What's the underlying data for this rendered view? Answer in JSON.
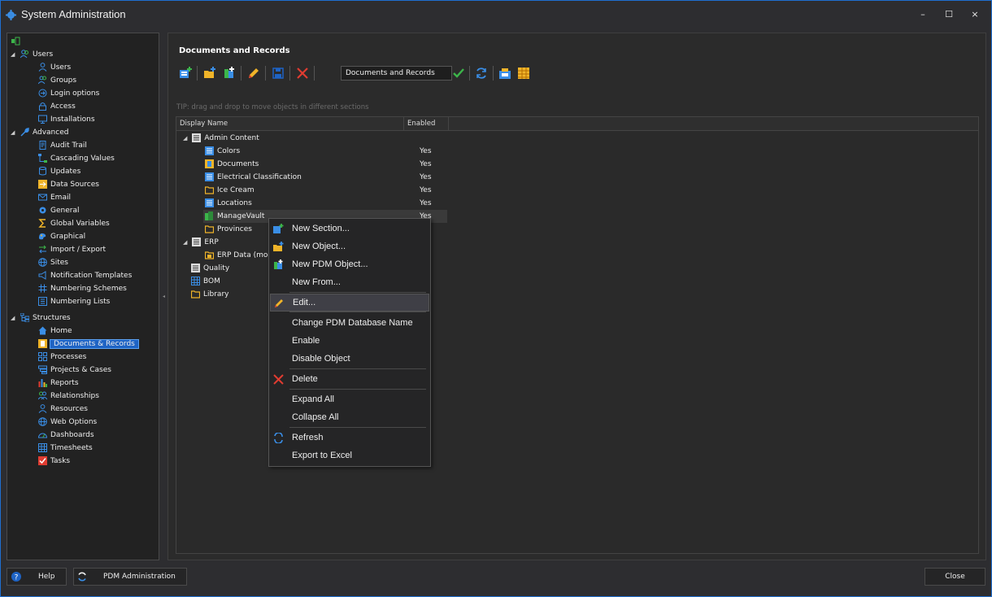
{
  "window": {
    "title": "System Administration",
    "minimize": "–",
    "maximize": "☐",
    "close": "×"
  },
  "sidebar": {
    "root_icon": "app-root-icon",
    "groups": [
      {
        "label": "Users",
        "items": [
          "Users",
          "Groups",
          "Login options",
          "Access",
          "Installations"
        ]
      },
      {
        "label": "Advanced",
        "items": [
          "Audit Trail",
          "Cascading Values",
          "Updates",
          "Data Sources",
          "Email",
          "General",
          "Global Variables",
          "Graphical",
          "Import / Export",
          "Sites",
          "Notification Templates",
          "Numbering Schemes",
          "Numbering Lists"
        ]
      },
      {
        "label": "Structures",
        "items": [
          "Home",
          "Documents & Records",
          "Processes",
          "Projects & Cases",
          "Reports",
          "Relationships",
          "Resources",
          "Web Options",
          "Dashboards",
          "Timesheets",
          "Tasks"
        ]
      }
    ],
    "selected": "Documents & Records"
  },
  "main": {
    "title": "Documents and Records",
    "name_field": "Documents and Records",
    "tip": "TIP: drag and drop to move objects in different sections",
    "columns": [
      "Display Name",
      "Enabled"
    ],
    "rows": [
      {
        "name": "Admin Content",
        "enabled": ""
      },
      {
        "name": "Colors",
        "enabled": "Yes"
      },
      {
        "name": "Documents",
        "enabled": "Yes"
      },
      {
        "name": "Electrical Classification",
        "enabled": "Yes"
      },
      {
        "name": "Ice Cream",
        "enabled": "Yes"
      },
      {
        "name": "Locations",
        "enabled": "Yes"
      },
      {
        "name": "ManageVault",
        "enabled": "Yes"
      },
      {
        "name": "Provinces",
        "enabled": ""
      },
      {
        "name": "ERP",
        "enabled": ""
      },
      {
        "name": "ERP Data (moc",
        "enabled": ""
      },
      {
        "name": "Quality",
        "enabled": ""
      },
      {
        "name": "BOM",
        "enabled": ""
      },
      {
        "name": "Library",
        "enabled": ""
      }
    ]
  },
  "context_menu": {
    "items": [
      "New Section...",
      "New Object...",
      "New PDM Object...",
      "New From...",
      "Edit...",
      "Change PDM Database Name",
      "Enable",
      "Disable Object",
      "Delete",
      "Expand All",
      "Collapse All",
      "Refresh",
      "Export to Excel"
    ],
    "highlighted": "Edit..."
  },
  "footer": {
    "help": "Help",
    "pdm_admin": "PDM Administration",
    "close": "Close"
  },
  "colors": {
    "accent": "#1e63c4",
    "border": "#1e6fd0",
    "icon_blue": "#3a8ee6",
    "icon_yellow": "#f0b429",
    "icon_red": "#e03c31",
    "icon_green": "#3cb54a"
  }
}
